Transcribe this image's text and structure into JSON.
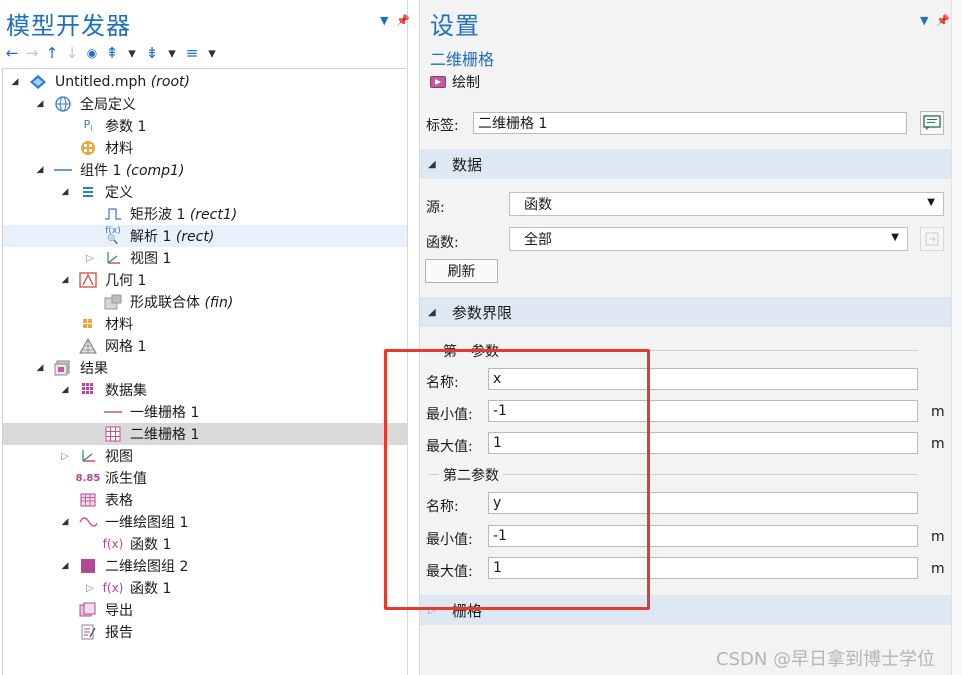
{
  "model_builder": {
    "title": "模型开发器",
    "toolbar": {
      "back_icon": "←",
      "forward_icon": "→",
      "up_icon": "↑",
      "down_icon": "↓",
      "eye_icon": "👁",
      "collapse_icon": "⇞",
      "expand_icon": "⇟",
      "list_icon": "≡",
      "dropdown": "▾"
    },
    "tree": [
      {
        "toggle": "◢",
        "icon": "mph",
        "label": "Untitled.mph",
        "tag": "(root)"
      },
      {
        "toggle": "◢",
        "icon": "globe",
        "label": "全局定义",
        "tag": ""
      },
      {
        "toggle": "",
        "icon": "Pi",
        "label": "参数 1",
        "tag": ""
      },
      {
        "toggle": "",
        "icon": "material",
        "label": "材料",
        "tag": ""
      },
      {
        "toggle": "◢",
        "icon": "component",
        "label": "组件 1",
        "tag": "(comp1)"
      },
      {
        "toggle": "◢",
        "icon": "definitions",
        "label": "定义",
        "tag": ""
      },
      {
        "toggle": "",
        "icon": "rect-wave",
        "label": "矩形波 1",
        "tag": "(rect1)"
      },
      {
        "toggle": "",
        "icon": "fx-search",
        "label": "解析 1",
        "tag": "(rect)"
      },
      {
        "toggle": "▷",
        "icon": "axes",
        "label": "视图 1",
        "tag": ""
      },
      {
        "toggle": "◢",
        "icon": "geometry",
        "label": "几何 1",
        "tag": ""
      },
      {
        "toggle": "",
        "icon": "union",
        "label": "形成联合体",
        "tag": "(fin)"
      },
      {
        "toggle": "",
        "icon": "material-small",
        "label": "材料",
        "tag": ""
      },
      {
        "toggle": "",
        "icon": "mesh",
        "label": "网格 1",
        "tag": ""
      },
      {
        "toggle": "◢",
        "icon": "results",
        "label": "结果",
        "tag": ""
      },
      {
        "toggle": "◢",
        "icon": "datasets",
        "label": "数据集",
        "tag": ""
      },
      {
        "toggle": "",
        "icon": "line-grid",
        "label": "一维栅格 1",
        "tag": ""
      },
      {
        "toggle": "",
        "icon": "grid-2d",
        "label": "二维栅格 1",
        "tag": ""
      },
      {
        "toggle": "▷",
        "icon": "axes",
        "label": "视图",
        "tag": ""
      },
      {
        "toggle": "",
        "icon": "derived",
        "label": "派生值",
        "tag": ""
      },
      {
        "toggle": "",
        "icon": "table",
        "label": "表格",
        "tag": ""
      },
      {
        "toggle": "◢",
        "icon": "wave",
        "label": "一维绘图组 1",
        "tag": ""
      },
      {
        "toggle": "",
        "icon": "fx",
        "label": "函数 1",
        "tag": ""
      },
      {
        "toggle": "◢",
        "icon": "plot2d",
        "label": "二维绘图组 2",
        "tag": ""
      },
      {
        "toggle": "▷",
        "icon": "fx",
        "label": "函数 1",
        "tag": ""
      },
      {
        "toggle": "",
        "icon": "export",
        "label": "导出",
        "tag": ""
      },
      {
        "toggle": "",
        "icon": "report",
        "label": "报告",
        "tag": ""
      }
    ]
  },
  "settings": {
    "title": "设置",
    "subtitle": "二维栅格",
    "plot_label": "绘制",
    "label_field": {
      "label": "标签:",
      "value": "二维栅格 1"
    },
    "data_section": {
      "title": "数据",
      "source_label": "源:",
      "source_value": "函数",
      "function_label": "函数:",
      "function_value": "全部",
      "refresh_label": "刷新"
    },
    "param_bounds_section": {
      "title": "参数界限",
      "first": {
        "title": "第一参数",
        "name_label": "名称:",
        "name_value": "x",
        "min_label": "最小值:",
        "min_value": "-1",
        "max_label": "最大值:",
        "max_value": "1",
        "unit": "m"
      },
      "second": {
        "title": "第二参数",
        "name_label": "名称:",
        "name_value": "y",
        "min_label": "最小值:",
        "min_value": "-1",
        "max_label": "最大值:",
        "max_value": "1",
        "unit": "m"
      }
    },
    "grid_section": {
      "title": "栅格"
    }
  },
  "watermark": "CSDN @早日拿到博士学位",
  "colors": {
    "accent": "#1e6fbf",
    "section_bg": "#dde8f3",
    "highlight_box": "#e53a2c",
    "selected_row": "#d9d9d9"
  }
}
